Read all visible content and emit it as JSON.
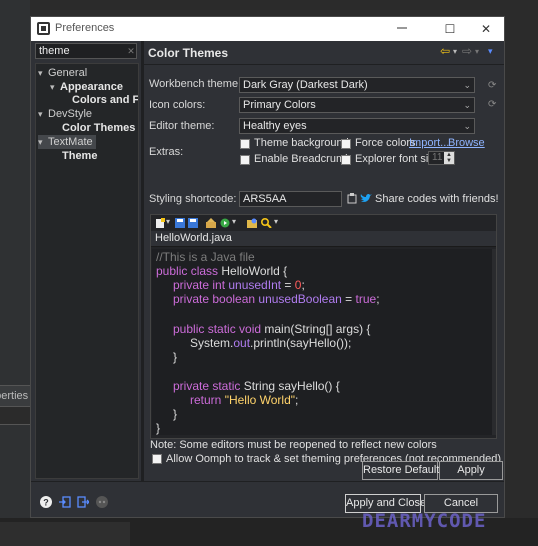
{
  "window": {
    "title": "Preferences",
    "minimize_label": "",
    "maximize_label": "☐",
    "close_label": "✕"
  },
  "tree": {
    "filter_value": "theme",
    "items": [
      {
        "label": "General",
        "twisty": "▾"
      },
      {
        "label": "Appearance",
        "twisty": "▾"
      },
      {
        "label": "Colors and Fonts",
        "twisty": ""
      },
      {
        "label": "DevStyle",
        "twisty": "▾"
      },
      {
        "label": "Color Themes",
        "twisty": ""
      },
      {
        "label": "TextMate",
        "twisty": "▾"
      },
      {
        "label": "Theme",
        "twisty": ""
      }
    ]
  },
  "page": {
    "title": "Color Themes",
    "workbench_theme_label": "Workbench theme:",
    "workbench_theme_value": "Dark Gray (Darkest Dark)",
    "icon_colors_label": "Icon colors:",
    "icon_colors_value": "Primary Colors",
    "editor_theme_label": "Editor theme:",
    "editor_theme_value": "Healthy eyes",
    "extras_label": "Extras:",
    "theme_background_label": "Theme background",
    "force_colors_label": "Force colors",
    "import_link": "Import...",
    "browse_link": "Browse",
    "enable_breadcrumb_label": "Enable Breadcrumb",
    "explorer_font_size_label": "Explorer font size",
    "explorer_font_size_value": "11",
    "styling_shortcode_label": "Styling shortcode:",
    "styling_shortcode_value": "ARS5AA",
    "share_codes_label": "Share codes with friends!",
    "note": "Note: Some editors must be reopened to reflect new colors",
    "oomph_label": "Allow Oomph to track & set theming preferences (not recommended)"
  },
  "preview": {
    "tab_label": "HelloWorld.java",
    "code_lines": [
      {
        "text": "//This is a Java file"
      },
      {
        "text": "public class HelloWorld {"
      },
      {
        "text": "private int unusedInt = 0;"
      },
      {
        "text": "private boolean unusedBoolean = true;"
      },
      {
        "text": ""
      },
      {
        "text": "public static void main(String[] args) {"
      },
      {
        "text": "System.out.println(sayHello());"
      },
      {
        "text": "}"
      },
      {
        "text": ""
      },
      {
        "text": "private static String sayHello() {"
      },
      {
        "text": "return \"Hello World\";"
      },
      {
        "text": "}"
      },
      {
        "text": "}"
      }
    ]
  },
  "buttons": {
    "restore_defaults": "Restore Defaults",
    "apply": "Apply",
    "apply_and_close": "Apply and Close",
    "cancel": "Cancel"
  },
  "background": {
    "properties_tab": "Properties"
  },
  "watermark": "DEARMYCODE",
  "colors": {
    "dialog_bg": "#2f3136",
    "accent_arrow": "#f5c518",
    "link": "#8fb4ff",
    "keyword": "#cc6cd9",
    "string": "#ffd36b",
    "comment": "#7d7d7d"
  }
}
